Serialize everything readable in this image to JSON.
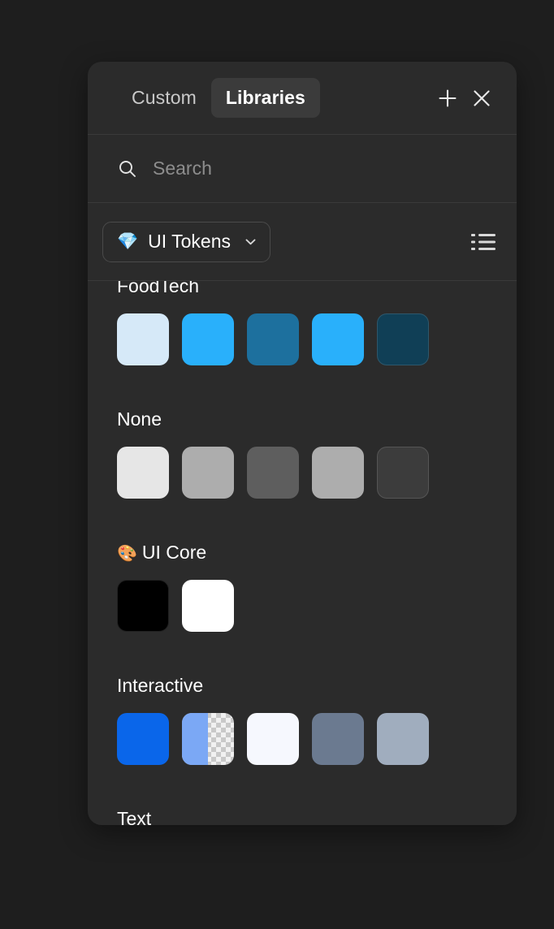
{
  "window": {
    "background": "#1e1e1e",
    "panel_background": "#2b2b2b"
  },
  "header": {
    "tabs": [
      {
        "label": "Custom",
        "active": false
      },
      {
        "label": "Libraries",
        "active": true
      }
    ],
    "add_button": "add-icon",
    "close_button": "close-icon"
  },
  "search": {
    "icon": "search-icon",
    "value": "",
    "placeholder": "Search"
  },
  "selector": {
    "library_emoji": "💎",
    "library_name": "UI Tokens",
    "chevron": "chevron-down-icon",
    "view_toggle_icon": "list-view-icon"
  },
  "groups": [
    {
      "title": "FoodTech",
      "emoji": "",
      "clipped": true,
      "swatches": [
        {
          "color": "#d6e9f8",
          "alpha": false
        },
        {
          "color": "#29b0fb",
          "alpha": false
        },
        {
          "color": "#1d709e",
          "alpha": false
        },
        {
          "color": "#29b0fb",
          "alpha": false
        },
        {
          "color": "#103f56",
          "alpha": false
        }
      ]
    },
    {
      "title": "None",
      "emoji": "",
      "clipped": false,
      "swatches": [
        {
          "color": "#e6e6e6",
          "alpha": false
        },
        {
          "color": "#adadad",
          "alpha": false
        },
        {
          "color": "#5e5e5e",
          "alpha": false
        },
        {
          "color": "#adadad",
          "alpha": false
        },
        {
          "color": "#3c3c3c",
          "alpha": false
        }
      ]
    },
    {
      "title": "UI Core",
      "emoji": "🎨",
      "clipped": false,
      "swatches": [
        {
          "color": "#000000",
          "alpha": false
        },
        {
          "color": "#ffffff",
          "alpha": false
        }
      ]
    },
    {
      "title": "Interactive",
      "emoji": "",
      "clipped": false,
      "swatches": [
        {
          "color": "#0a66ea",
          "alpha": false
        },
        {
          "color": "#7ba8f5",
          "alpha": true
        },
        {
          "color": "#f6f8fe",
          "alpha": false
        },
        {
          "color": "#6b7a90",
          "alpha": false
        },
        {
          "color": "#a0adbe",
          "alpha": false
        }
      ]
    },
    {
      "title": "Text",
      "emoji": "",
      "clipped": false,
      "swatches": [
        {
          "color": "#1468f0",
          "alpha": false
        }
      ]
    }
  ]
}
